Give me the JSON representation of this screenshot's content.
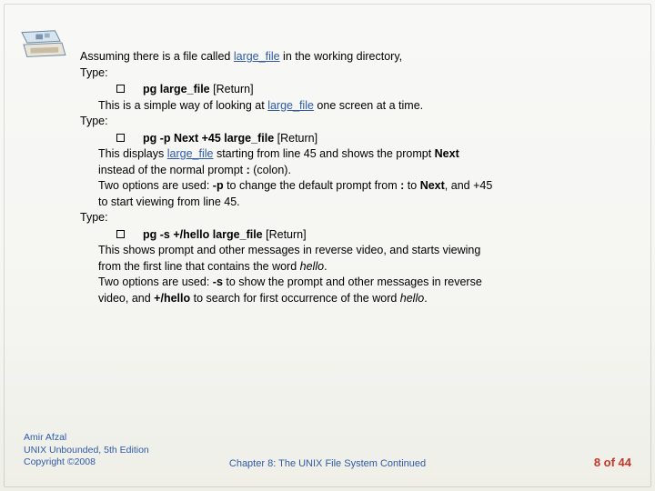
{
  "intro": {
    "pre": "Assuming there is a file called ",
    "link": "large_file",
    "post": " in the working directory,"
  },
  "type_label": "Type:",
  "ex1": {
    "cmd": {
      "bold": "pg large_file",
      "rest": " [Return]"
    },
    "l1a": "This is a simple way of looking at ",
    "l1link": "large_file",
    "l1b": " one screen at a time."
  },
  "ex2": {
    "cmd": {
      "bold": "pg -p Next +45 large_file",
      "rest": " [Return]"
    },
    "l1a": "This displays ",
    "l1link": "large_file",
    "l1b": " starting from line 45 and shows the prompt ",
    "l1bold": "Next",
    "l2a": "instead of the normal prompt ",
    "l2b": ":",
    "l2c": " (colon).",
    "l3a": "Two options are used: ",
    "l3b": "-p",
    "l3c": " to change the default prompt from ",
    "l3d": ":",
    "l3e": " to ",
    "l3f": "Next",
    "l3g": ", and +45",
    "l4": "to start viewing from line 45."
  },
  "ex3": {
    "cmd": {
      "bold": "pg -s +/hello large_file",
      "rest": " [Return]"
    },
    "l1": "This shows prompt and other messages in reverse video, and starts viewing",
    "l2a": "from the first line that contains the word ",
    "l2b": "hello",
    "l2c": ".",
    "l3a": "Two options are used: ",
    "l3b": "-s",
    "l3c": " to show the prompt and other messages in reverse",
    "l4a": "video, and ",
    "l4b": "+/hello",
    "l4c": " to search for first occurrence of the word ",
    "l4d": "hello",
    "l4e": "."
  },
  "footer": {
    "author": "Amir Afzal",
    "book": "UNIX Unbounded, 5th Edition",
    "copy": "Copyright ©2008",
    "chapter": "Chapter 8: The UNIX File System Continued",
    "page": "8 of 44"
  }
}
